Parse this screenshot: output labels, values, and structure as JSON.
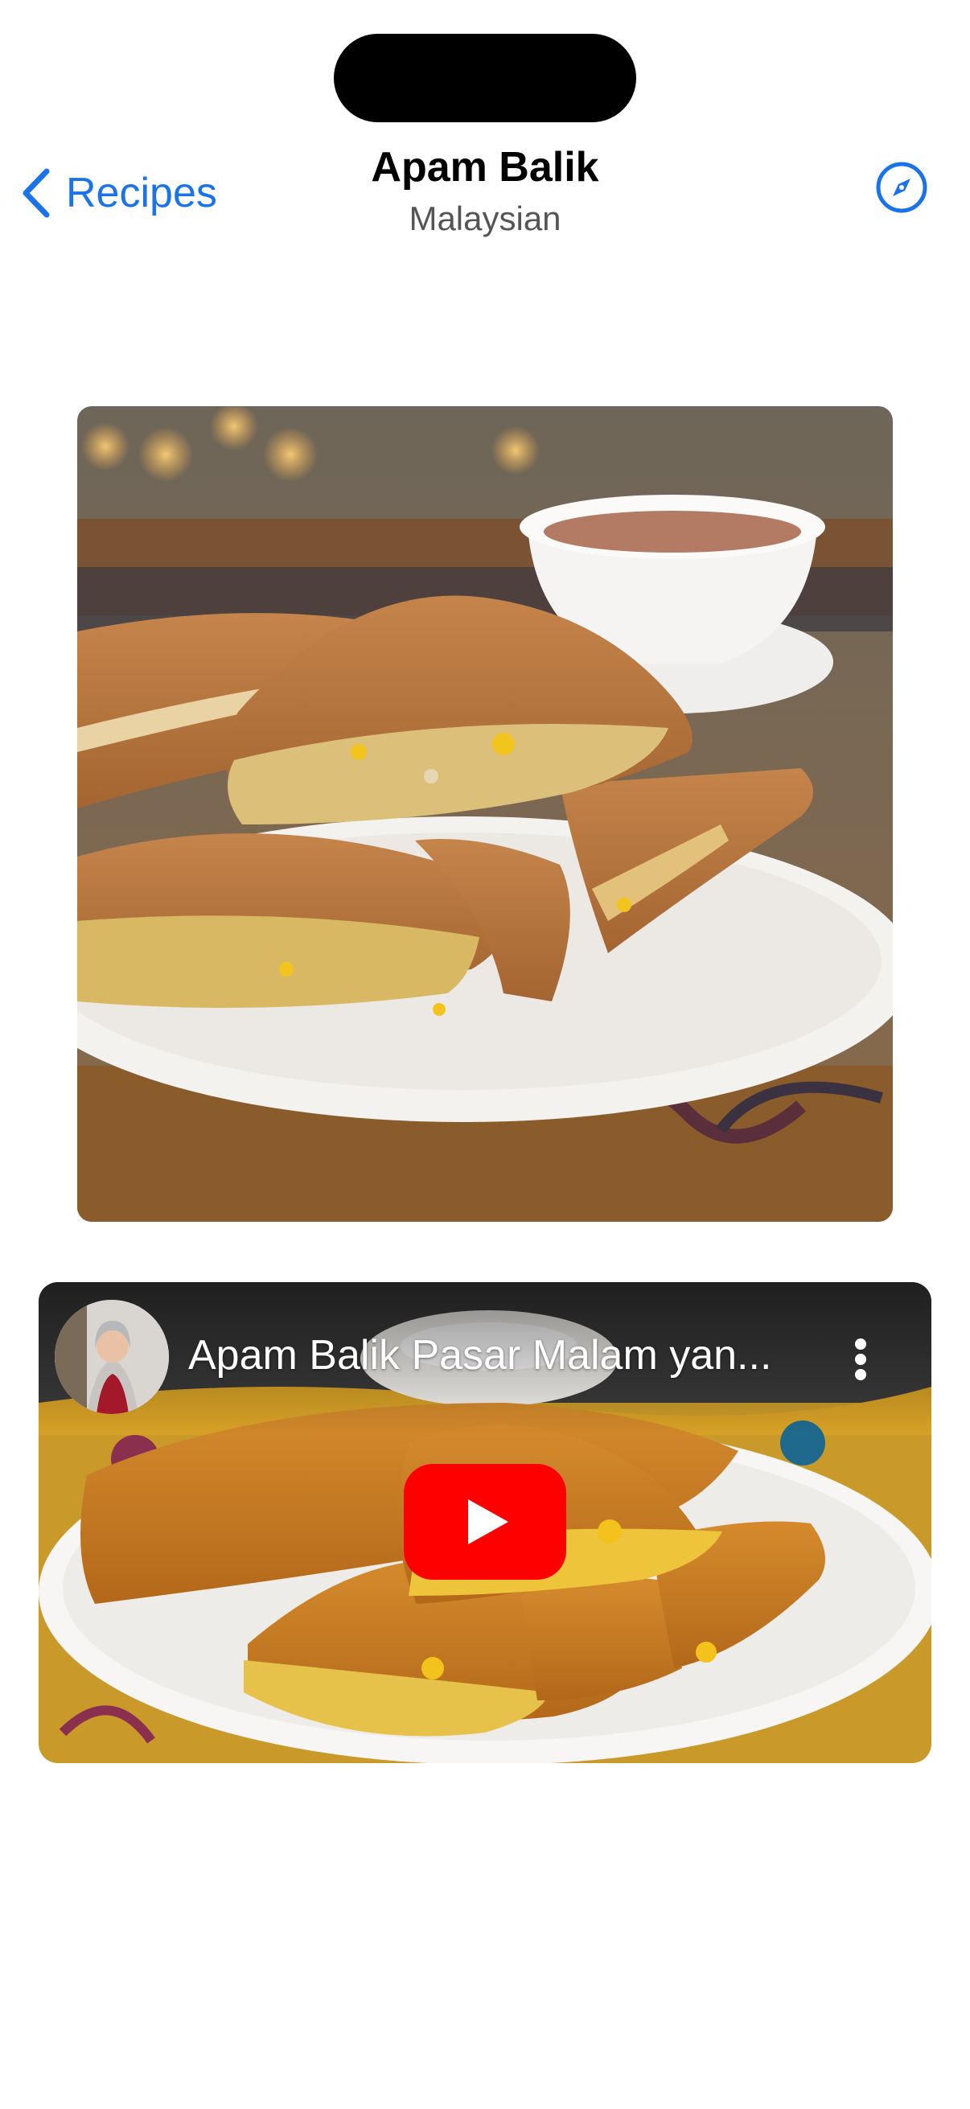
{
  "nav": {
    "back_label": "Recipes",
    "title": "Apam Balik",
    "subtitle": "Malaysian",
    "back_icon": "chevron-left-icon",
    "safari_icon": "compass-icon"
  },
  "video": {
    "title": "Apam Balik Pasar Malam yan...",
    "play_icon": "youtube-play-icon",
    "more_icon": "more-vertical-icon"
  },
  "colors": {
    "accent": "#1a73e8",
    "youtube_red": "#ff0000"
  }
}
